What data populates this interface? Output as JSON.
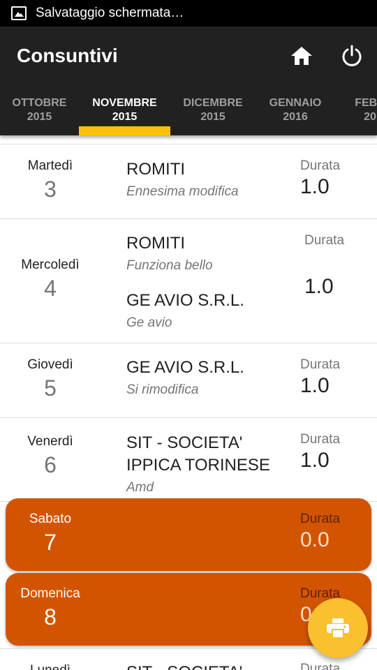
{
  "status_bar": {
    "notification": "Salvataggio schermata…",
    "icon": "image-icon"
  },
  "app_bar": {
    "title": "Consuntivi",
    "home_icon": "home-icon",
    "power_icon": "power-icon"
  },
  "tabs": [
    {
      "month": "OTTOBRE",
      "year": "2015"
    },
    {
      "month": "NOVEMBRE",
      "year": "2015"
    },
    {
      "month": "DICEMBRE",
      "year": "2015"
    },
    {
      "month": "GENNAIO",
      "year": "2016"
    },
    {
      "month": "FEBB",
      "year": "20"
    }
  ],
  "active_tab": "NOVEMBRE 2015",
  "colors": {
    "weekend_card": "#d35400",
    "tab_indicator": "#ffc107",
    "fab": "#fbc02d",
    "app_bar": "#212121"
  },
  "days": [
    {
      "day_name": "Martedì",
      "day_num": "3",
      "entries": [
        {
          "client": "ROMITI",
          "note": "Ennesima modifica"
        }
      ],
      "duration_label": "Durata",
      "duration": "1.0"
    },
    {
      "day_name": "Mercoledì",
      "day_num": "4",
      "entries": [
        {
          "client": "ROMITI",
          "note": "Funziona bello"
        },
        {
          "client": "GE AVIO S.R.L.",
          "note": "Ge avio"
        }
      ],
      "duration_label": "Durata",
      "duration": "1.0"
    },
    {
      "day_name": "Giovedì",
      "day_num": "5",
      "entries": [
        {
          "client": "GE AVIO S.R.L.",
          "note": "Si rimodifica"
        }
      ],
      "duration_label": "Durata",
      "duration": "1.0"
    },
    {
      "day_name": "Venerdì",
      "day_num": "6",
      "entries": [
        {
          "client_line1": "SIT - SOCIETA'",
          "client_line2": "IPPICA TORINESE",
          "note": "Amd"
        }
      ],
      "duration_label": "Durata",
      "duration": "1.0"
    },
    {
      "day_name": "Sabato",
      "day_num": "7",
      "weekend": true,
      "duration_label": "Durata",
      "duration": "0.0"
    },
    {
      "day_name": "Domenica",
      "day_num": "8",
      "weekend": true,
      "duration_label": "Durata",
      "duration": "0"
    },
    {
      "day_name": "Lunedì",
      "client": "SIT - SOCIETA'",
      "duration_label": "Durata"
    }
  ],
  "fab": {
    "icon": "print-icon"
  }
}
